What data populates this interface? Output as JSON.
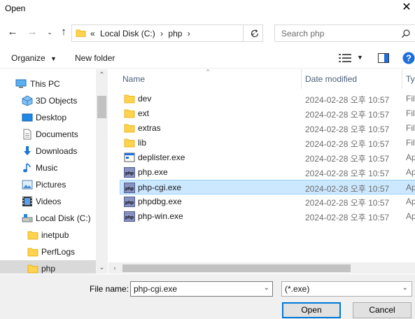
{
  "window": {
    "title": "Open"
  },
  "address": {
    "chevrons": "«",
    "crumbs": [
      {
        "label": "Local Disk (C:)",
        "sep": "›"
      },
      {
        "label": "php",
        "sep": "›"
      }
    ]
  },
  "search": {
    "placeholder": "Search php"
  },
  "toolbar": {
    "organize_label": "Organize",
    "new_folder_label": "New folder"
  },
  "navigation": {
    "items": [
      {
        "label": "This PC",
        "icon": "this-pc-icon"
      },
      {
        "label": "3D Objects",
        "icon": "3d-objects-icon"
      },
      {
        "label": "Desktop",
        "icon": "desktop-icon"
      },
      {
        "label": "Documents",
        "icon": "documents-icon"
      },
      {
        "label": "Downloads",
        "icon": "downloads-icon"
      },
      {
        "label": "Music",
        "icon": "music-icon"
      },
      {
        "label": "Pictures",
        "icon": "pictures-icon"
      },
      {
        "label": "Videos",
        "icon": "videos-icon"
      },
      {
        "label": "Local Disk (C:)",
        "icon": "local-disk-icon"
      },
      {
        "label": "inetpub",
        "icon": "folder-icon"
      },
      {
        "label": "PerfLogs",
        "icon": "folder-icon"
      },
      {
        "label": "php",
        "icon": "folder-icon",
        "selected": true
      }
    ]
  },
  "columns": {
    "name": "Name",
    "date": "Date modified",
    "type": "Typ"
  },
  "files": [
    {
      "name": "dev",
      "date": "2024-02-28 오후 10:57",
      "type": "Fil",
      "icon": "folder-icon"
    },
    {
      "name": "ext",
      "date": "2024-02-28 오후 10:57",
      "type": "Fil",
      "icon": "folder-icon"
    },
    {
      "name": "extras",
      "date": "2024-02-28 오후 10:57",
      "type": "Fil",
      "icon": "folder-icon"
    },
    {
      "name": "lib",
      "date": "2024-02-28 오후 10:57",
      "type": "Fil",
      "icon": "folder-icon"
    },
    {
      "name": "deplister.exe",
      "date": "2024-02-28 오후 10:57",
      "type": "Ap",
      "icon": "exe-icon"
    },
    {
      "name": "php.exe",
      "date": "2024-02-28 오후 10:57",
      "type": "Ap",
      "icon": "php-exe-icon"
    },
    {
      "name": "php-cgi.exe",
      "date": "2024-02-28 오후 10:57",
      "type": "Ap",
      "icon": "php-exe-icon",
      "selected": true
    },
    {
      "name": "phpdbg.exe",
      "date": "2024-02-28 오후 10:57",
      "type": "Ap",
      "icon": "php-exe-icon"
    },
    {
      "name": "php-win.exe",
      "date": "2024-02-28 오후 10:57",
      "type": "Ap",
      "icon": "php-exe-icon"
    }
  ],
  "bottom": {
    "filename_label": "File name:",
    "filename_value": "php-cgi.exe",
    "filetype_value": "(*.exe)",
    "open_label": "Open",
    "cancel_label": "Cancel"
  },
  "colors": {
    "accent": "#0078d7",
    "selection": "#cce8ff",
    "folder": "#ffd34e",
    "help": "#1e6fd9"
  }
}
